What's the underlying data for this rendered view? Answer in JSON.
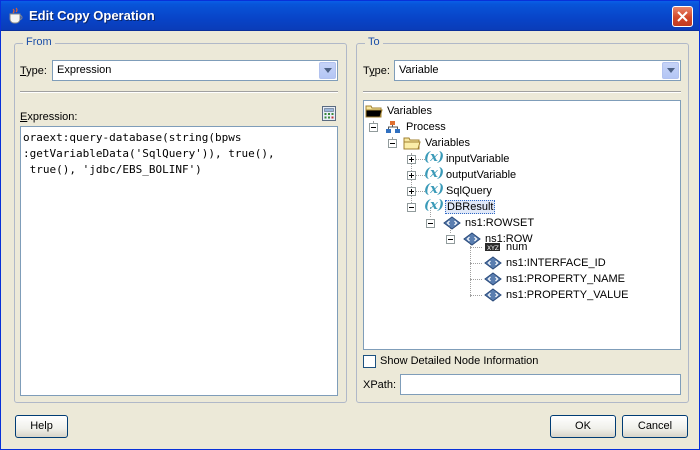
{
  "window": {
    "title": "Edit Copy Operation"
  },
  "from": {
    "legend": "From",
    "type_label": "Type:",
    "type_value": "Expression",
    "expression_label": "Expression:",
    "expression_text": "oraext:query-database(string(bpws\n:getVariableData('SqlQuery')), true(),\n true(), 'jdbc/EBS_BOLINF')"
  },
  "to": {
    "legend": "To",
    "type_label": "Type:",
    "type_value": "Variable",
    "tree": [
      {
        "label": "Variables",
        "icon": "folder-icon"
      },
      {
        "label": "Process",
        "icon": "process-icon"
      },
      {
        "label": "Variables",
        "icon": "folder-icon"
      },
      {
        "label": "inputVariable",
        "icon": "variable-icon"
      },
      {
        "label": "outputVariable",
        "icon": "variable-icon"
      },
      {
        "label": "SqlQuery",
        "icon": "variable-icon"
      },
      {
        "label": "DBResult",
        "icon": "variable-icon"
      },
      {
        "label": "ns1:ROWSET",
        "icon": "element-icon"
      },
      {
        "label": "ns1:ROW",
        "icon": "element-icon"
      },
      {
        "label": "num",
        "icon": "attribute-icon"
      },
      {
        "label": "ns1:INTERFACE_ID",
        "icon": "element-icon"
      },
      {
        "label": "ns1:PROPERTY_NAME",
        "icon": "element-icon"
      },
      {
        "label": "ns1:PROPERTY_VALUE",
        "icon": "element-icon"
      }
    ],
    "show_detailed_label": "Show Detailed Node Information",
    "xpath_label": "XPath:",
    "xpath_value": ""
  },
  "buttons": {
    "help": "Help",
    "ok": "OK",
    "cancel": "Cancel"
  }
}
